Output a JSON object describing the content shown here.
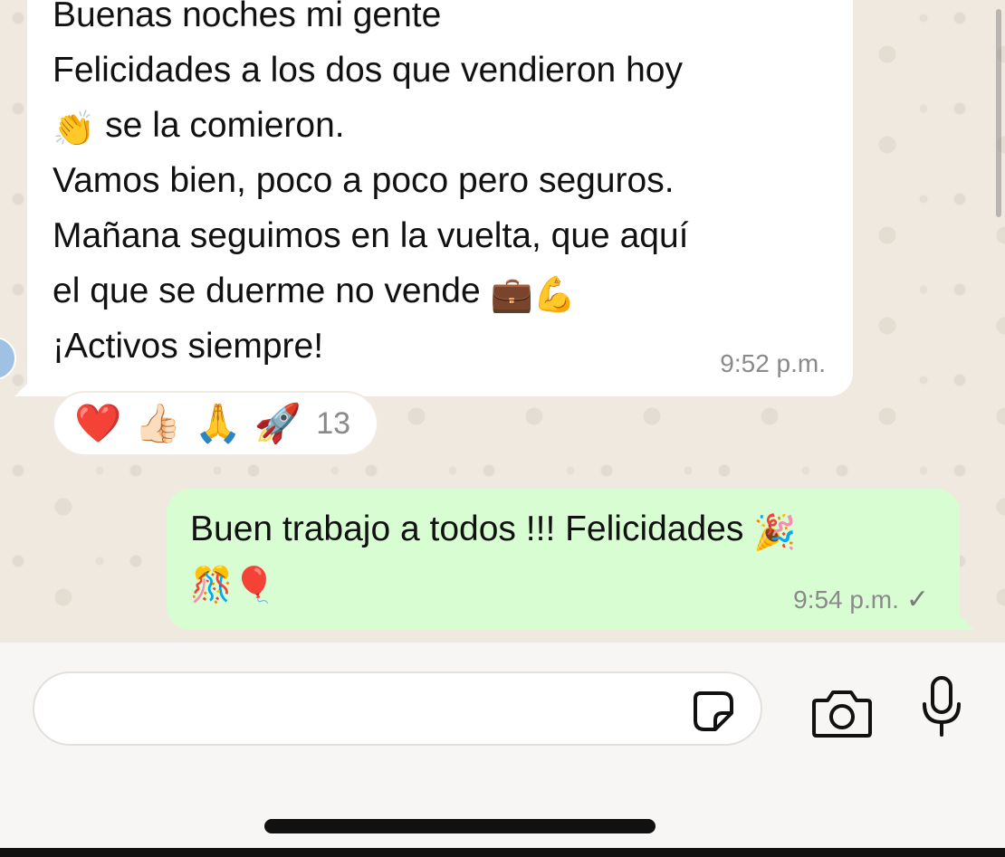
{
  "incoming_message": {
    "lines": [
      "Buenas noches mi gente",
      "Felicidades a los dos que vendieron hoy",
      "se la comieron.",
      "Vamos bien, poco a poco pero seguros.",
      "Mañana seguimos en la vuelta, que aquí",
      "el que se duerme no vende",
      "¡Activos siempre!"
    ],
    "emojis": {
      "clap": "👏",
      "briefcase": "💼",
      "muscle": "💪"
    },
    "time": "9:52 p.m."
  },
  "reactions": {
    "emojis": [
      "❤️",
      "👍🏻",
      "🙏",
      "🚀"
    ],
    "count": "13"
  },
  "outgoing_message": {
    "lines": [
      "Buen trabajo a todos !!! Felicidades"
    ],
    "emojis": {
      "party_popper": "🎉",
      "confetti_ball": "🎊",
      "balloon": "🎈"
    },
    "time": "9:54 p.m.",
    "status_icon": "✓"
  },
  "composer": {
    "input_value": "",
    "icons": [
      "sticker-icon",
      "camera-icon",
      "microphone-icon"
    ]
  },
  "colors": {
    "incoming_bubble": "#ffffff",
    "outgoing_bubble": "#d9fdd3",
    "chat_background": "#efeae2",
    "timestamp": "#8a8a8a"
  }
}
